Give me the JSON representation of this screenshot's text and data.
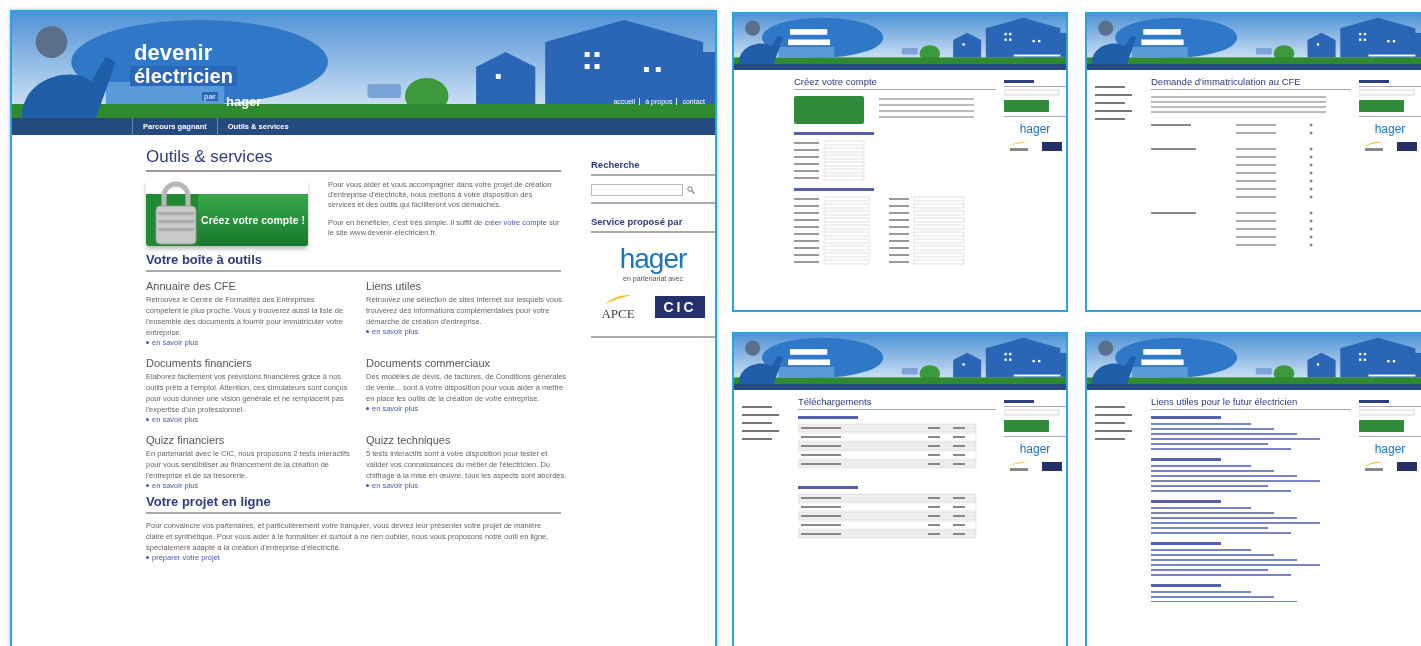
{
  "main": {
    "logo": {
      "line1": "devenir",
      "line2": "électricien",
      "by": "par",
      "brand": "hager"
    },
    "header_links": [
      "accueil",
      "à propos",
      "contact"
    ],
    "nav": [
      "Parcours gagnant",
      "Outils & services"
    ],
    "title": "Outils & services",
    "promo_button": "Créez votre compte !",
    "intro": "Pour vous aider et vous accompagner dans votre projet de création d'entreprise d'électricité, nous mettons à votre disposition des services et des outils qui faciliteront vos démarches.",
    "intro_link": {
      "before": "Pour en bénéficier, c'est très simple. Il suffit de ",
      "link": "créer votre compte",
      "after": " sur le site www.devenir-electricien.fr."
    },
    "toolbox": {
      "heading": "Votre boîte à outils",
      "tools": [
        {
          "title": "Annuaire des CFE",
          "text": "Retrouvez le Centre de Formalités des Entreprises compétent le plus proche. Vous y trouverez aussi la liste de l'ensemble des documents à fournir pour immatriculer votre entreprise.",
          "link": "en savoir plus"
        },
        {
          "title": "Liens utiles",
          "text": "Retrouvez une sélection de sites Internet sur lesquels vous trouverez des informations complémentaires pour votre démarche de création d'entreprise.",
          "link": "en savoir plus"
        },
        {
          "title": "Documents financiers",
          "text": "Elaborez facilement vos prévisions financières grâce à nos outils prêts à l'emploi. Attention, ces simulateurs sont conçus pour vous donner une vision générale et ne remplacent pas l'expertise d'un professionnel.",
          "link": "en savoir plus"
        },
        {
          "title": "Documents commerciaux",
          "text": "Des modèles de devis, de factures, de Conditions générales de vente... sont à votre disposition pour vous aider à mettre en place les outils de la création de votre entreprise.",
          "link": "en savoir plus"
        },
        {
          "title": "Quizz financiers",
          "text": "En partenariat avec le CIC, nous proposons 2 tests interactifs pour vous sensibiliser au financement de la création de l'entreprise et de sa trésorerie.",
          "link": "en savoir plus"
        },
        {
          "title": "Quizz techniques",
          "text": "5 tests interactifs sont à votre disposition pour tester et valider vos connaissances du métier de l'électricien. Du chiffrage à la mise en œuvre, tous les aspects sont abordés.",
          "link": "en savoir plus"
        }
      ]
    },
    "project": {
      "heading": "Votre projet en ligne",
      "text": "Pour convaincre vos partenaires, et particulièrement votre banquier, vous devrez leur présenter votre projet de manière claire et synthétique. Pour vous aider à le formaliser et surtout à ne rien oublier, nous vous proposons notre outil en ligne, spécialement adapté à la création d'entreprise d'électricité.",
      "link": "préparer votre projet"
    },
    "sidebar": {
      "search_title": "Recherche",
      "partner_title": "Service proposé par",
      "brand": "hager",
      "brand_note": "en partenariat avec",
      "partners": [
        "APCE",
        "CIC"
      ]
    }
  },
  "thumbnails": [
    {
      "title": "Créez votre compte",
      "kind": "form",
      "left_menu": false,
      "brand": "hager"
    },
    {
      "title": "Demande d'immatriculation au CFE",
      "kind": "options",
      "left_menu": true,
      "brand": "hager"
    },
    {
      "title": "Téléchargements",
      "kind": "table",
      "left_menu": true,
      "brand": "hager"
    },
    {
      "title": "Liens utiles pour le futur électricien",
      "kind": "links",
      "left_menu": true,
      "brand": "hager"
    }
  ]
}
